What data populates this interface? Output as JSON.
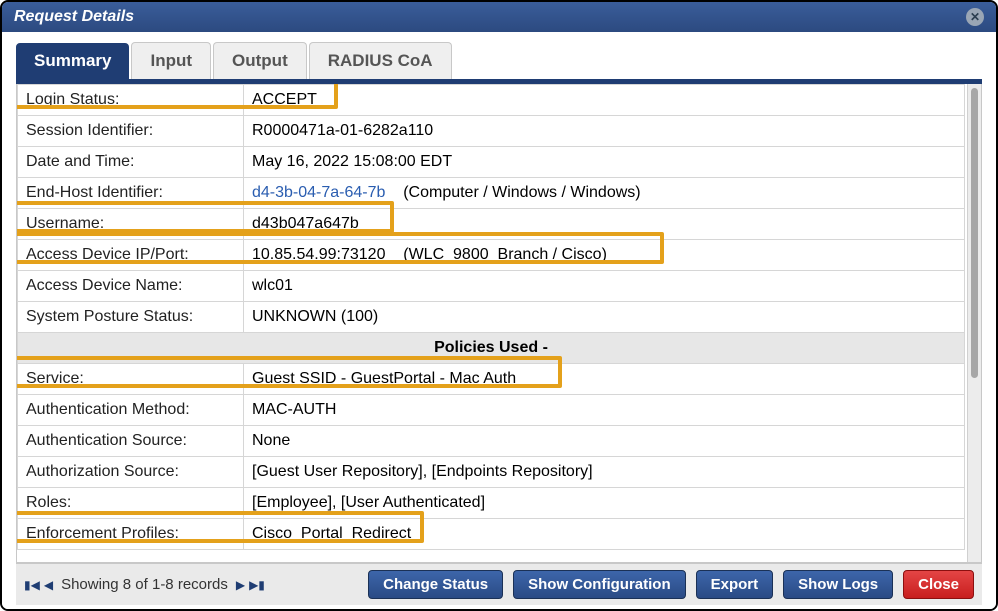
{
  "window": {
    "title": "Request Details"
  },
  "tabs": {
    "summary": "Summary",
    "input": "Input",
    "output": "Output",
    "radius_coa": "RADIUS CoA"
  },
  "rows": {
    "login_status": {
      "label": "Login Status:",
      "value": "ACCEPT"
    },
    "session_identifier": {
      "label": "Session Identifier:",
      "value": "R0000471a-01-6282a110"
    },
    "date_time": {
      "label": "Date and Time:",
      "value": "May 16, 2022 15:08:00 EDT"
    },
    "end_host_identifier": {
      "label": "End-Host Identifier:",
      "link": "d4-3b-04-7a-64-7b",
      "extra": "(Computer / Windows / Windows)"
    },
    "username": {
      "label": "Username:",
      "value": "d43b047a647b"
    },
    "access_device_ip_port": {
      "label": "Access Device IP/Port:",
      "value": "10.85.54.99:73120",
      "extra": "(WLC_9800_Branch / Cisco)"
    },
    "access_device_name": {
      "label": "Access Device Name:",
      "value": "wlc01"
    },
    "system_posture_status": {
      "label": "System Posture Status:",
      "value": "UNKNOWN (100)"
    }
  },
  "section_policies": "Policies Used -",
  "policy_rows": {
    "service": {
      "label": "Service:",
      "value": "Guest SSID - GuestPortal - Mac Auth"
    },
    "authentication_method": {
      "label": "Authentication Method:",
      "value": "MAC-AUTH"
    },
    "authentication_source": {
      "label": "Authentication Source:",
      "value": "None"
    },
    "authorization_source": {
      "label": "Authorization Source:",
      "value": "[Guest User Repository], [Endpoints Repository]"
    },
    "roles": {
      "label": "Roles:",
      "value": "[Employee], [User Authenticated]"
    },
    "enforcement_profiles": {
      "label": "Enforcement Profiles:",
      "value": "Cisco_Portal_Redirect"
    }
  },
  "footer": {
    "pager_text": "Showing 8 of 1-8 records",
    "change_status": "Change Status",
    "show_configuration": "Show Configuration",
    "export": "Export",
    "show_logs": "Show Logs",
    "close": "Close"
  }
}
